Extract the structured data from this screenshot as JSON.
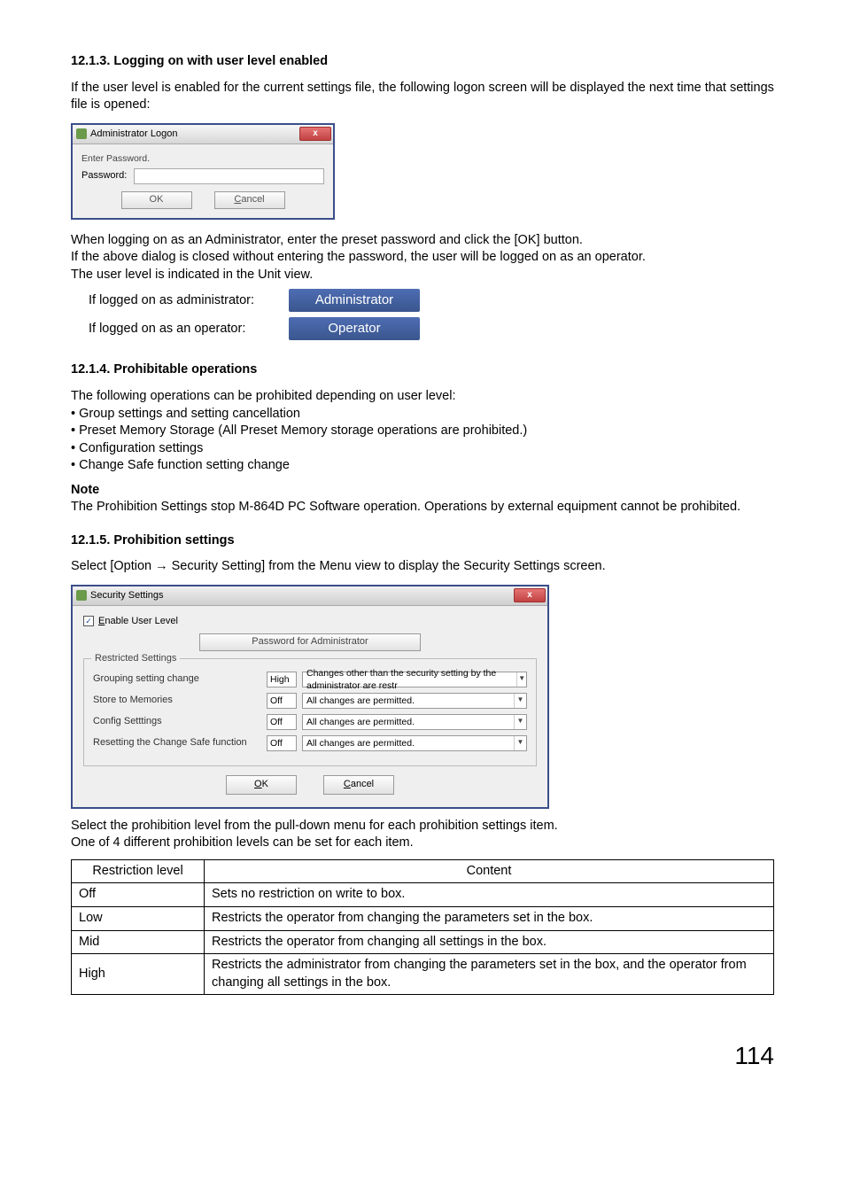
{
  "sections": {
    "s1_title": "12.1.3. Logging on with user level enabled",
    "s1_p1": "If the user level is enabled for the current settings file, the following logon screen will be displayed the next time that settings file is opened:",
    "s1_after1": "When logging on as an Administrator, enter the preset password and click the [OK] button.",
    "s1_after2": "If the above dialog is closed without entering the password, the user will be logged on as an operator.",
    "s1_after3": "The user level is indicated in the Unit view.",
    "role_admin_label": "If logged on as administrator:",
    "role_op_label": "If logged on as an operator:",
    "role_admin_pill": "Administrator",
    "role_op_pill": "Operator",
    "s2_title": "12.1.4. Prohibitable operations",
    "s2_p1": "The following operations can be prohibited depending on user level:",
    "s2_b1": "• Group settings and setting cancellation",
    "s2_b2": "• Preset Memory Storage (All Preset Memory storage operations are prohibited.)",
    "s2_b3": "• Configuration settings",
    "s2_b4": "• Change Safe function setting change",
    "note_title": "Note",
    "note_body": "The Prohibition Settings stop M-864D PC Software operation. Operations by external equipment cannot be prohibited.",
    "s3_title": "12.1.5. Prohibition settings",
    "s3_p1": "Select [Option → Security Setting] from the Menu view to display the Security Settings screen.",
    "s3_after1": "Select the prohibition level from the pull-down menu for each prohibition settings item.",
    "s3_after2": "One of 4 different prohibition levels can be set for each item."
  },
  "dialog1": {
    "title": "Administrator Logon",
    "close_glyph": "x",
    "enter_label": "Enter Password.",
    "password_label": "Password:",
    "ok_label": "OK",
    "cancel_prefix": "C",
    "cancel_rest": "ancel"
  },
  "dialog2": {
    "title": "Security Settings",
    "close_glyph": "x",
    "enable_prefix": "E",
    "enable_rest": "nable User Level",
    "pw_btn": "Password for Administrator",
    "legend": "Restricted Settings",
    "rows": [
      {
        "name": "Grouping setting change",
        "level": "High",
        "desc": "Changes other than the security setting by the administrator are restr"
      },
      {
        "name": "Store to Memories",
        "level": "Off",
        "desc": "All changes are permitted."
      },
      {
        "name": "Config Setttings",
        "level": "Off",
        "desc": "All changes are permitted."
      },
      {
        "name": "Resetting the Change Safe function",
        "level": "Off",
        "desc": "All changes are permitted."
      }
    ],
    "ok_prefix": "O",
    "ok_rest": "K",
    "cancel_prefix": "C",
    "cancel_rest": "ancel"
  },
  "table": {
    "h_level": "Restriction level",
    "h_content": "Content",
    "rows": [
      {
        "level": "Off",
        "content": "Sets no restriction on write to box."
      },
      {
        "level": "Low",
        "content": "Restricts the operator from changing the parameters set in the box."
      },
      {
        "level": "Mid",
        "content": "Restricts the operator from changing all settings in the box."
      },
      {
        "level": "High",
        "content": "Restricts the administrator from changing the parameters set in the box, and the operator from changing all settings in the box."
      }
    ]
  },
  "page_number": "114"
}
